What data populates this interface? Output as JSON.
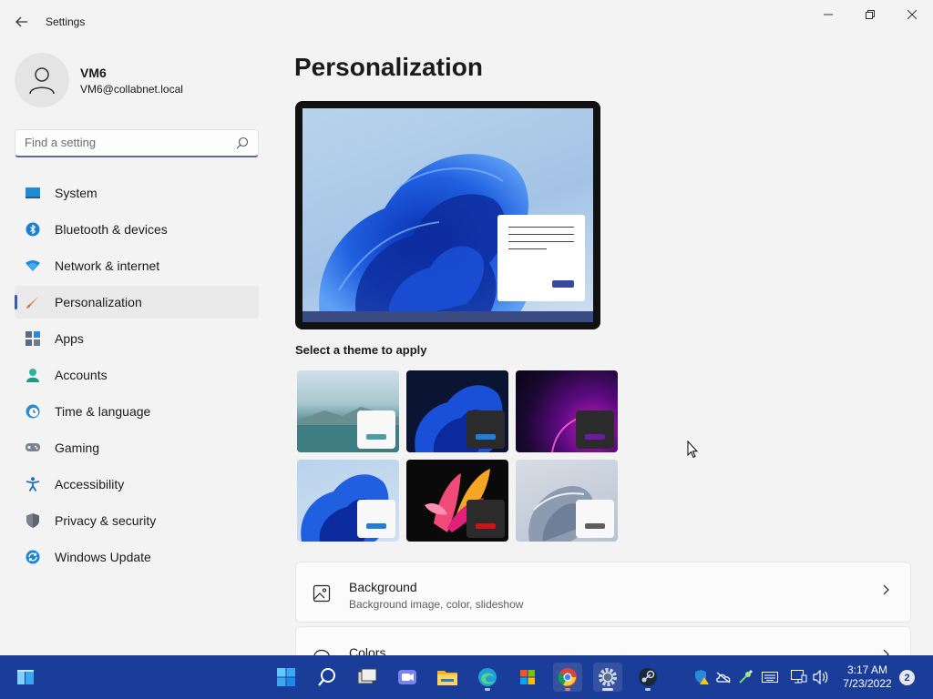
{
  "window": {
    "back_icon": "back-arrow-icon",
    "title": "Settings",
    "controls": [
      "minimize-icon",
      "maximize-icon",
      "close-icon"
    ]
  },
  "user": {
    "name": "VM6",
    "email": "VM6@collabnet.local",
    "avatar_icon": "person-icon"
  },
  "search": {
    "placeholder": "Find a setting",
    "icon": "search-icon"
  },
  "nav": {
    "items": [
      {
        "label": "System",
        "icon": "monitor-icon"
      },
      {
        "label": "Bluetooth & devices",
        "icon": "bluetooth-icon"
      },
      {
        "label": "Network & internet",
        "icon": "wifi-icon"
      },
      {
        "label": "Personalization",
        "icon": "paintbrush-icon",
        "active": true
      },
      {
        "label": "Apps",
        "icon": "apps-icon"
      },
      {
        "label": "Accounts",
        "icon": "account-icon"
      },
      {
        "label": "Time & language",
        "icon": "clock-globe-icon"
      },
      {
        "label": "Gaming",
        "icon": "gamepad-icon"
      },
      {
        "label": "Accessibility",
        "icon": "accessibility-icon"
      },
      {
        "label": "Privacy & security",
        "icon": "shield-icon"
      },
      {
        "label": "Windows Update",
        "icon": "update-icon"
      }
    ]
  },
  "main": {
    "title": "Personalization",
    "theme_heading": "Select a theme to apply",
    "themes": [
      {
        "name": "lake",
        "accent": "#4e9ca4"
      },
      {
        "name": "bloom-dark",
        "accent": "#1f7ed8"
      },
      {
        "name": "glow",
        "accent": "#6a1aa0"
      },
      {
        "name": "bloom-light",
        "accent": "#1f7ed8"
      },
      {
        "name": "captured-motion",
        "accent": "#d01218"
      },
      {
        "name": "flow",
        "accent": "#5d5d5d"
      }
    ],
    "cards": [
      {
        "title": "Background",
        "subtitle": "Background image, color, slideshow",
        "icon": "image-icon"
      },
      {
        "title": "Colors",
        "subtitle": "",
        "icon": "palette-icon"
      }
    ]
  },
  "taskbar": {
    "apps": [
      "windows-start-icon",
      "search-icon",
      "task-view-icon",
      "teams-chat-icon",
      "file-explorer-icon",
      "edge-icon",
      "microsoft-store-icon",
      "chrome-icon",
      "settings-icon",
      "steam-icon"
    ],
    "tray": [
      "defender-warning-icon",
      "onedrive-icon",
      "network-tool-icon",
      "keyboard-icon",
      "network-icon",
      "volume-icon"
    ],
    "time": "3:17 AM",
    "date": "7/23/2022",
    "notifications": "2"
  },
  "colors": {
    "accent": "#3a5aa8",
    "taskbar": "#1a3d9a"
  }
}
